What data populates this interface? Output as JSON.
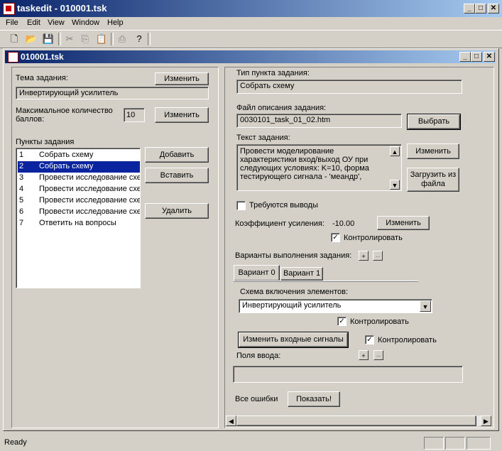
{
  "window": {
    "title": "taskedit - 010001.tsk"
  },
  "menu": [
    "File",
    "Edit",
    "View",
    "Window",
    "Help"
  ],
  "toolbar": {
    "icons": [
      "new-icon",
      "open-icon",
      "save-icon",
      "cut-icon",
      "copy-icon",
      "paste-icon",
      "print-icon",
      "help-icon"
    ]
  },
  "doc": {
    "title": "010001.tsk"
  },
  "left": {
    "topic_label": "Тема задания:",
    "topic_change": "Изменить",
    "topic_value": "Инвертирующий усилитель",
    "max_label1": "Максимальное количество",
    "max_label2": "баллов:",
    "max_value": "10",
    "max_change": "Изменить",
    "items_label": "Пункты задания",
    "items": [
      {
        "n": "1",
        "text": "Собрать схему"
      },
      {
        "n": "2",
        "text": "Собрать схему"
      },
      {
        "n": "3",
        "text": "Провести исследование схе"
      },
      {
        "n": "4",
        "text": "Провести исследование схе"
      },
      {
        "n": "5",
        "text": "Провести исследование схе"
      },
      {
        "n": "6",
        "text": "Провести исследование схе"
      },
      {
        "n": "7",
        "text": "Ответить на вопросы"
      }
    ],
    "add": "Добавить",
    "insert": "Вставить",
    "delete": "Удалить"
  },
  "right": {
    "type_label": "Тип пункта задания:",
    "type_value": "Собрать схему",
    "file_label": "Файл описания задания:",
    "file_value": "0030101_task_01_02.htm",
    "choose": "Выбрать",
    "text_label": "Текст задания:",
    "text_lines": [
      "Провести моделирование",
      "характеристики вход/выход ОУ при",
      "следующих условиях: K=10, форма",
      "тестирующего сигнала - 'меандр',"
    ],
    "text_change": "Изменить",
    "load1": "Загрузить из",
    "load2": "файла",
    "need_conclusions": "Требуются выводы",
    "gain_label": "Коэффициент усиления:",
    "gain_value": "-10.00",
    "gain_change": "Изменить",
    "control": "Контролировать",
    "variants_label": "Варианты выполнения задания:",
    "tabs": [
      "Вариант 0",
      "Вариант 1"
    ],
    "scheme_label": "Схема включения элементов:",
    "scheme_value": "Инвертирующий усилитель",
    "control2": "Контролировать",
    "change_inputs": "Изменить входные сигналы",
    "control3": "Контролировать",
    "input_fields": "Поля ввода:",
    "all_errors": "Все ошибки",
    "show": "Показать!"
  },
  "status": {
    "text": "Ready"
  }
}
